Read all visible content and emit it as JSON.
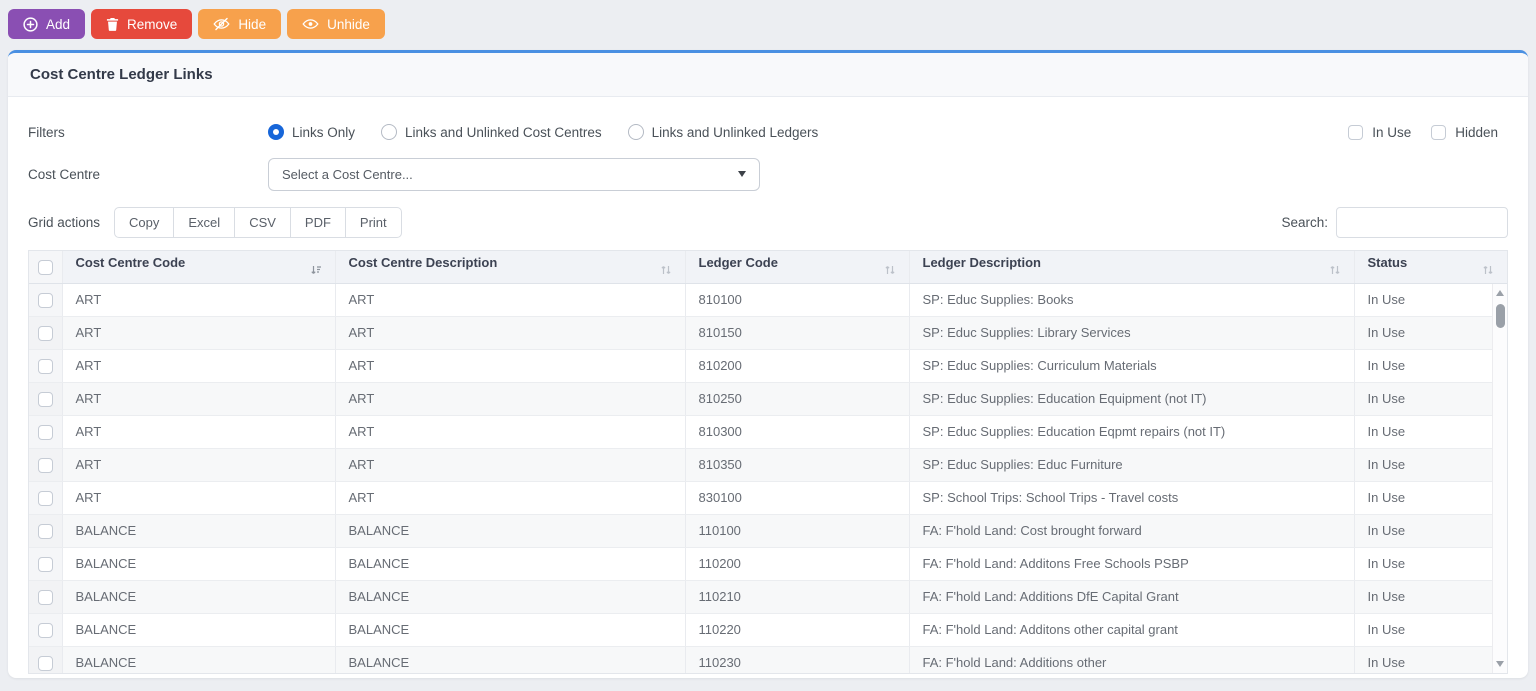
{
  "toolbar": {
    "add_label": "Add",
    "remove_label": "Remove",
    "hide_label": "Hide",
    "unhide_label": "Unhide"
  },
  "card": {
    "title": "Cost Centre Ledger Links"
  },
  "filters": {
    "label": "Filters",
    "options": [
      {
        "label": "Links Only",
        "selected": true
      },
      {
        "label": "Links and Unlinked Cost Centres",
        "selected": false
      },
      {
        "label": "Links and Unlinked Ledgers",
        "selected": false
      }
    ],
    "checkboxes": [
      {
        "label": "In Use",
        "checked": false
      },
      {
        "label": "Hidden",
        "checked": false
      }
    ]
  },
  "cost_centre": {
    "label": "Cost Centre",
    "selected_value": "Select a Cost Centre..."
  },
  "grid_actions": {
    "label": "Grid actions",
    "buttons": [
      "Copy",
      "Excel",
      "CSV",
      "PDF",
      "Print"
    ]
  },
  "search": {
    "label": "Search:",
    "value": ""
  },
  "table": {
    "columns": [
      "Cost Centre Code",
      "Cost Centre Description",
      "Ledger Code",
      "Ledger Description",
      "Status"
    ],
    "sorted_column": "Cost Centre Code",
    "sort_direction": "asc",
    "rows": [
      [
        "ART",
        "ART",
        "810100",
        "SP: Educ Supplies: Books",
        "In Use"
      ],
      [
        "ART",
        "ART",
        "810150",
        "SP: Educ Supplies: Library Services",
        "In Use"
      ],
      [
        "ART",
        "ART",
        "810200",
        "SP: Educ Supplies: Curriculum Materials",
        "In Use"
      ],
      [
        "ART",
        "ART",
        "810250",
        "SP: Educ Supplies: Education Equipment (not IT)",
        "In Use"
      ],
      [
        "ART",
        "ART",
        "810300",
        "SP: Educ Supplies: Education Eqpmt repairs (not IT)",
        "In Use"
      ],
      [
        "ART",
        "ART",
        "810350",
        "SP: Educ Supplies: Educ Furniture",
        "In Use"
      ],
      [
        "ART",
        "ART",
        "830100",
        "SP: School Trips: School Trips - Travel costs",
        "In Use"
      ],
      [
        "BALANCE",
        "BALANCE",
        "110100",
        "FA: F'hold Land: Cost brought forward",
        "In Use"
      ],
      [
        "BALANCE",
        "BALANCE",
        "110200",
        "FA: F'hold Land: Additons Free Schools PSBP",
        "In Use"
      ],
      [
        "BALANCE",
        "BALANCE",
        "110210",
        "FA: F'hold Land: Additions DfE Capital Grant",
        "In Use"
      ],
      [
        "BALANCE",
        "BALANCE",
        "110220",
        "FA: F'hold Land: Additons other capital grant",
        "In Use"
      ],
      [
        "BALANCE",
        "BALANCE",
        "110230",
        "FA: F'hold Land: Additions other",
        "In Use"
      ]
    ]
  },
  "colors": {
    "c-add": "#8a4fb3",
    "c-remove": "#e6493c",
    "c-orange": "#f7a14c",
    "c-cardtop": "#4a90e2",
    "c-radio": "#1766d9"
  }
}
